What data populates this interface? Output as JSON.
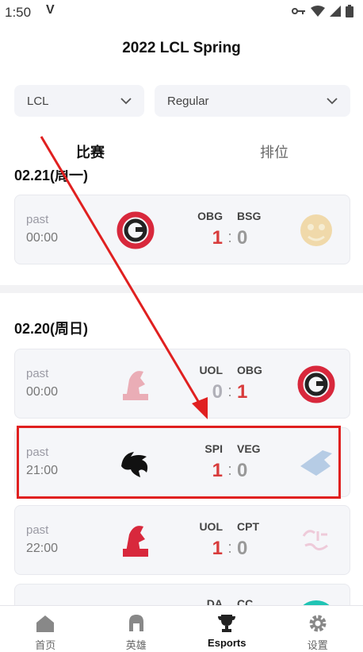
{
  "status_bar": {
    "time": "1:50",
    "app_mark": "V"
  },
  "header": {
    "title": "2022 LCL Spring"
  },
  "filters": {
    "league": "LCL",
    "stage": "Regular"
  },
  "tabs": [
    {
      "label": "比赛",
      "active": true
    },
    {
      "label": "排位",
      "active": false
    }
  ],
  "sections": [
    {
      "date": "02.21(周一)"
    },
    {
      "date": "02.20(周日)"
    }
  ],
  "matches": [
    {
      "status": "past",
      "time": "00:00",
      "team_left": "OBG",
      "team_right": "BSG",
      "score_left": "1",
      "score_right": "0",
      "logo_left": "obg-logo",
      "logo_right": "bsg-logo"
    },
    {
      "status": "past",
      "time": "00:00",
      "team_left": "UOL",
      "team_right": "OBG",
      "score_left": "0",
      "score_right": "1",
      "logo_left": "uol-logo",
      "logo_right": "obg-logo"
    },
    {
      "status": "past",
      "time": "21:00",
      "team_left": "SPI",
      "team_right": "VEG",
      "score_left": "1",
      "score_right": "0",
      "logo_left": "spirit-logo",
      "logo_right": "vega-logo"
    },
    {
      "status": "past",
      "time": "22:00",
      "team_left": "UOL",
      "team_right": "CPT",
      "score_left": "1",
      "score_right": "0",
      "logo_left": "uol-logo",
      "logo_right": "cpt-logo"
    },
    {
      "team_left": "DA",
      "team_right": "CC"
    }
  ],
  "bottom_nav": [
    {
      "label": "首页",
      "icon": "home-icon"
    },
    {
      "label": "英雄",
      "icon": "helmet-icon"
    },
    {
      "label": "Esports",
      "icon": "trophy-icon",
      "active": true
    },
    {
      "label": "设置",
      "icon": "gear-icon"
    }
  ],
  "colors": {
    "accent_red": "#d83b3b",
    "highlight_red": "#e02020",
    "card_bg": "#f5f6f9"
  }
}
